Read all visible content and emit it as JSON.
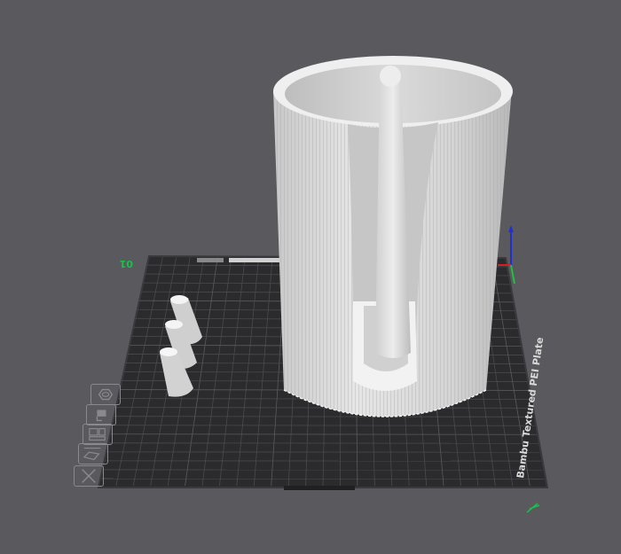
{
  "viewport": {
    "plate_name": "Bambu Textured PEI Plate",
    "plate_number": "01",
    "colors": {
      "background": "#59595e",
      "plate": "#2b2b2e",
      "grid": "#4a4a4e",
      "model": "#d8d8d8",
      "axis_x": "#d02020",
      "axis_y": "#20c040",
      "axis_z": "#2030d0",
      "plate_number": "#19c04a"
    }
  },
  "plate_toolbar": {
    "icons": [
      "orient-icon",
      "auto-arrange-icon",
      "plate-settings-icon",
      "edit-plate-icon",
      "delete-plate-icon"
    ]
  }
}
